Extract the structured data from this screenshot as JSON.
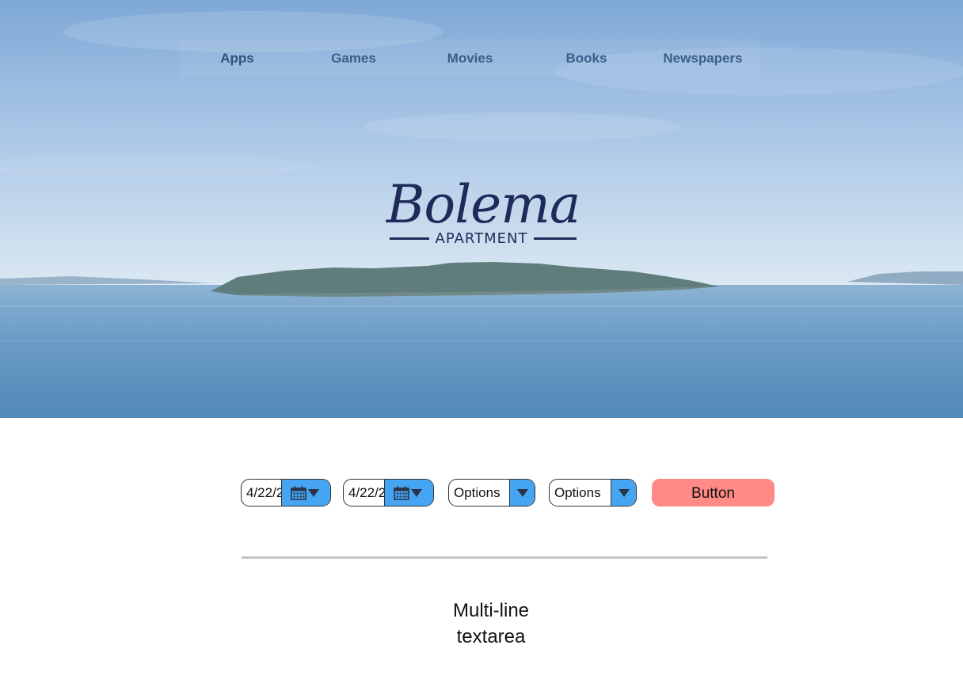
{
  "nav": {
    "items": [
      {
        "label": "Apps"
      },
      {
        "label": "Games"
      },
      {
        "label": "Movies"
      },
      {
        "label": "Books"
      },
      {
        "label": "Newspapers"
      }
    ]
  },
  "logo": {
    "script": "Bolema",
    "subtitle": "APARTMENT"
  },
  "form": {
    "date_from": {
      "value": "4/22/2"
    },
    "date_to": {
      "value": "4/22/2"
    },
    "select_1": {
      "value": "Options"
    },
    "select_2": {
      "value": "Options"
    },
    "button_label": "Button"
  },
  "textarea": {
    "text": "Multi-line\ntextarea"
  },
  "colors": {
    "accent_blue": "#45a5f2",
    "button_pink": "#ff8a86",
    "logo_navy": "#1f2a5a",
    "nav_text": "#3a5f8a"
  },
  "icons": [
    "calendar-icon",
    "dropdown-arrow-icon"
  ]
}
